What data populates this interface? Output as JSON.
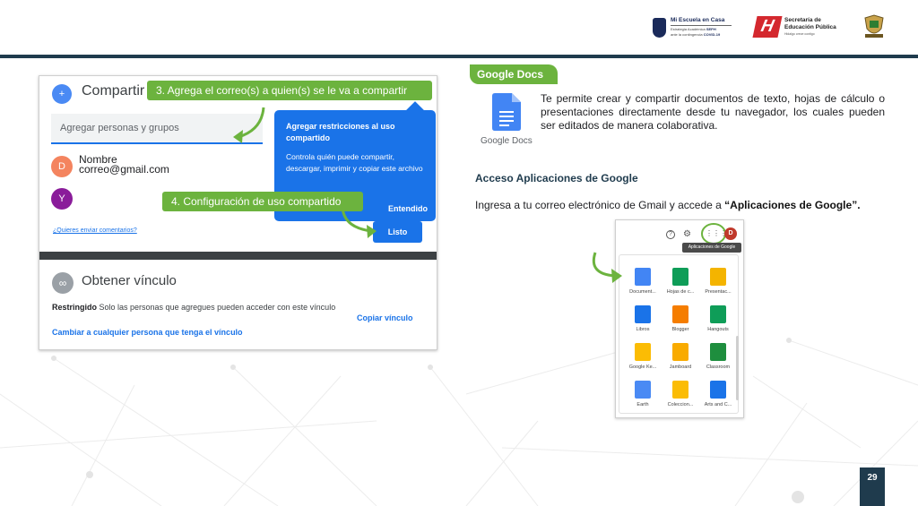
{
  "header": {
    "mec": {
      "title": "Mi Escuela en Casa",
      "line1_a": "Estrategia Académica",
      "line1_b": "SEPH",
      "line2_a": "ante la contingencia",
      "line2_b": "COVID-19"
    },
    "sep": {
      "mark": "H",
      "title_l1": "Secretaría de",
      "title_l2": "Educación Pública",
      "sub": "Hidalgo crece contigo"
    }
  },
  "share_panel": {
    "title": "Compartir",
    "callout_3": "3. Agrega el correo(s) a quien(s) se le va a compartir",
    "input_placeholder": "Agregar personas y grupos",
    "popup_title": "Agregar restricciones al uso compartido",
    "popup_text": "Controla quién puede compartir, descargar, imprimir y copiar este archivo",
    "popup_button": "Entendido",
    "person_1": {
      "initial": "D",
      "name": "Nombre",
      "email": "correo@gmail.com"
    },
    "person_2": {
      "initial": "Y"
    },
    "callout_4": "4. Configuración de uso compartido",
    "feedback_link": "¿Quieres enviar comentarios?",
    "done_button": "Listo",
    "link_title": "Obtener vínculo",
    "restricted_label": "Restringido",
    "restricted_text": " Solo las personas que agregues pueden acceder con este vínculo",
    "copy_link": "Copiar vínculo",
    "change_link": "Cambiar a cualquier persona que tenga el vínculo"
  },
  "docs_section": {
    "tab_label": "Google Docs",
    "icon_label": "Google Docs",
    "description": "Te permite crear y compartir documentos de texto, hojas de cálculo o presentaciones directamente desde tu navegador, los cuales pueden ser editados de manera colaborativa.",
    "access_title": "Acceso Aplicaciones de Google",
    "access_text": "Ingresa a tu correo electrónico de Gmail  y accede a ",
    "access_bold": "“Aplicaciones de Google”."
  },
  "apps_panel": {
    "help_icon": "?",
    "grid_icon": "⋮⋮⋮",
    "user_initial": "D",
    "tooltip": "Aplicaciones de Google",
    "apps": [
      {
        "name": "Document...",
        "color": "#4285f4"
      },
      {
        "name": "Hojas de c...",
        "color": "#0f9d58"
      },
      {
        "name": "Presentac...",
        "color": "#f4b400"
      },
      {
        "name": "Libros",
        "color": "#1a73e8"
      },
      {
        "name": "Blogger",
        "color": "#f57d00"
      },
      {
        "name": "Hangouts",
        "color": "#0f9d58"
      },
      {
        "name": "Google Ke...",
        "color": "#fbbc04"
      },
      {
        "name": "Jamboard",
        "color": "#f9ab00"
      },
      {
        "name": "Classroom",
        "color": "#1e8e3e"
      },
      {
        "name": "Earth",
        "color": "#4a8af4"
      },
      {
        "name": "Coleccion...",
        "color": "#fbbc04"
      },
      {
        "name": "Arts and C...",
        "color": "#1a73e8"
      }
    ]
  },
  "page_number": "29"
}
